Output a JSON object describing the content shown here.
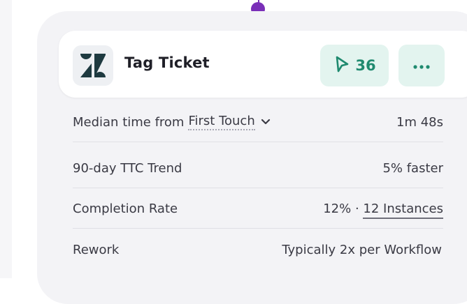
{
  "card": {
    "title": "Tag Ticket",
    "run_count": "36",
    "app_icon": "zendesk-logo",
    "more_icon": "ellipsis-icon",
    "run_icon": "play-cursor-icon"
  },
  "metrics": {
    "median": {
      "label_prefix": "Median time from",
      "dropdown_value": "First Touch",
      "value": "1m 48s"
    },
    "trend": {
      "label": "90-day TTC Trend",
      "value": "5% faster"
    },
    "completion": {
      "label": "Completion Rate",
      "rate": "12% ·",
      "instances": "12 Instances"
    },
    "rework": {
      "label": "Rework",
      "value": "Typically 2x per Workflow"
    }
  },
  "colors": {
    "accent_green": "#1f8a6f",
    "connector_purple": "#7a2fb8",
    "panel_bg": "#f3f3f6"
  }
}
